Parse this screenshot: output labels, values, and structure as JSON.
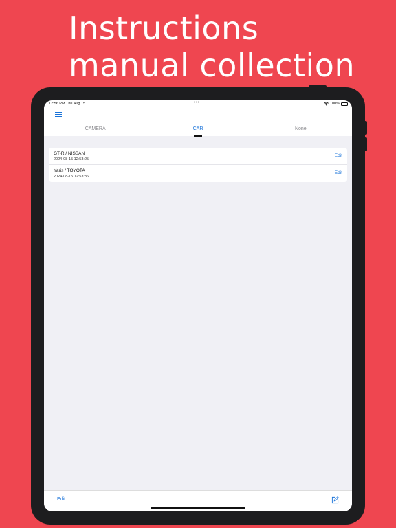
{
  "headline": {
    "line1": "Instructions",
    "line2": "manual collection"
  },
  "status_bar": {
    "time_date": "12:56 PM   Thu Aug 15",
    "dots": "•••",
    "battery": "100%"
  },
  "tabs": [
    {
      "label": "CAMERA",
      "active": false
    },
    {
      "label": "CAR",
      "active": true
    },
    {
      "label": "None",
      "active": false
    }
  ],
  "items": [
    {
      "title": "GT-R / NISSAN",
      "date": "2024-08-15 12:53:25",
      "action": "Edit"
    },
    {
      "title": "Yaris / TOYOTA",
      "date": "2024-08-15 12:53:36",
      "action": "Edit"
    }
  ],
  "toolbar": {
    "edit_label": "Edit",
    "compose_icon": "compose-icon"
  },
  "colors": {
    "background": "#EF4650",
    "accent": "#1a73d9",
    "device": "#1d1d1f",
    "screen_bg": "#f0f0f5"
  }
}
